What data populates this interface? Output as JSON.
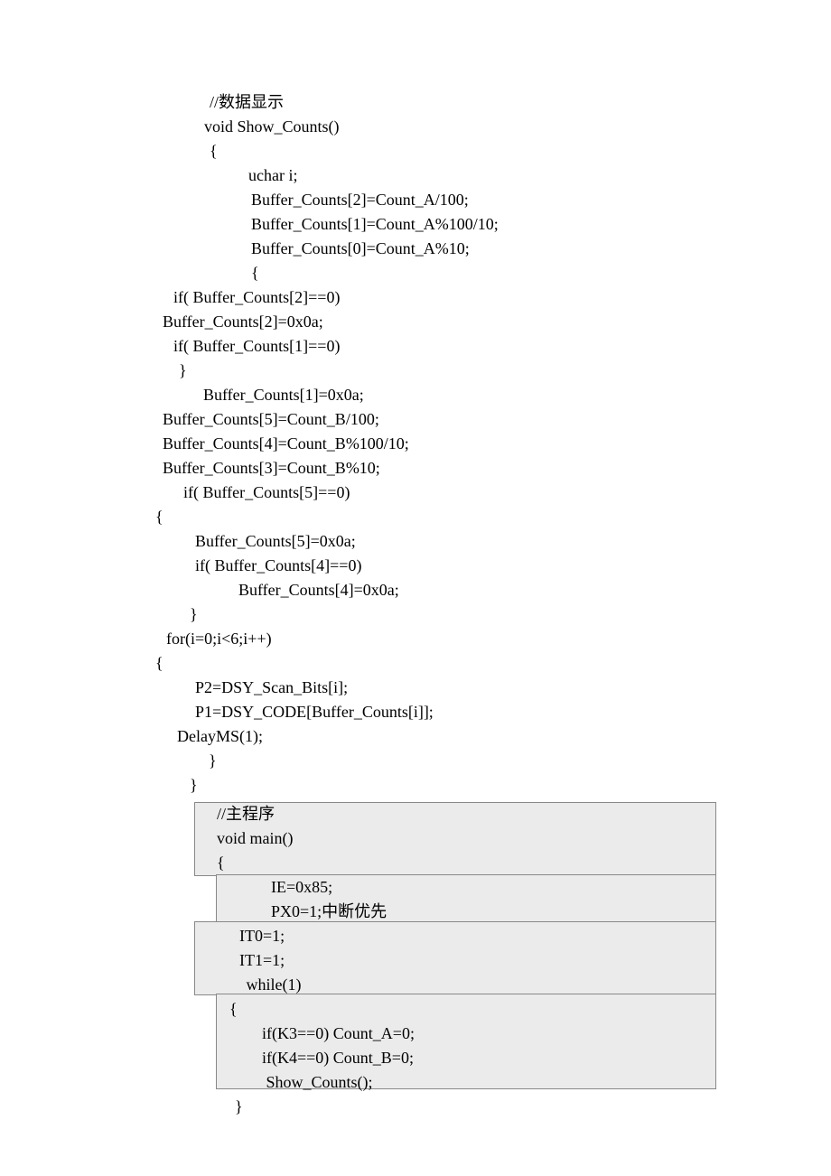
{
  "block1": {
    "l1": "//数据显示",
    "l2": "void Show_Counts()",
    "l3": "{",
    "l4": "uchar i;",
    "l5": "Buffer_Counts[2]=Count_A/100;",
    "l6": "Buffer_Counts[1]=Count_A%100/10;",
    "l7": "Buffer_Counts[0]=Count_A%10;",
    "l8": "{",
    "l9": "if( Buffer_Counts[2]==0)",
    "l10": "Buffer_Counts[2]=0x0a;",
    "l11": "if( Buffer_Counts[1]==0)",
    "l12": "}",
    "l13": "Buffer_Counts[1]=0x0a;",
    "l14": "Buffer_Counts[5]=Count_B/100;",
    "l15": "Buffer_Counts[4]=Count_B%100/10;",
    "l16": "Buffer_Counts[3]=Count_B%10;",
    "l17": "if( Buffer_Counts[5]==0)",
    "l18": "{",
    "l19": "Buffer_Counts[5]=0x0a;",
    "l20": "if( Buffer_Counts[4]==0)",
    "l21": "Buffer_Counts[4]=0x0a;",
    "l22": "}",
    "l23": "for(i=0;i<6;i++)",
    "l24": "{",
    "l25": "P2=DSY_Scan_Bits[i];",
    "l26": "P1=DSY_CODE[Buffer_Counts[i]];",
    "l27": "DelayMS(1);",
    "l28": "}",
    "l29": "}"
  },
  "block2": {
    "l1": "//主程序",
    "l2": "void main()",
    "l3": "{",
    "l4": "IE=0x85;",
    "l5": "PX0=1;中断优先",
    "l6": "IT0=1;",
    "l7": "IT1=1;",
    "l8": " while(1)",
    "l9": "{",
    "l10": "if(K3==0) Count_A=0;",
    "l11": "if(K4==0) Count_B=0;",
    "l12": " Show_Counts();",
    "l13": "}"
  }
}
